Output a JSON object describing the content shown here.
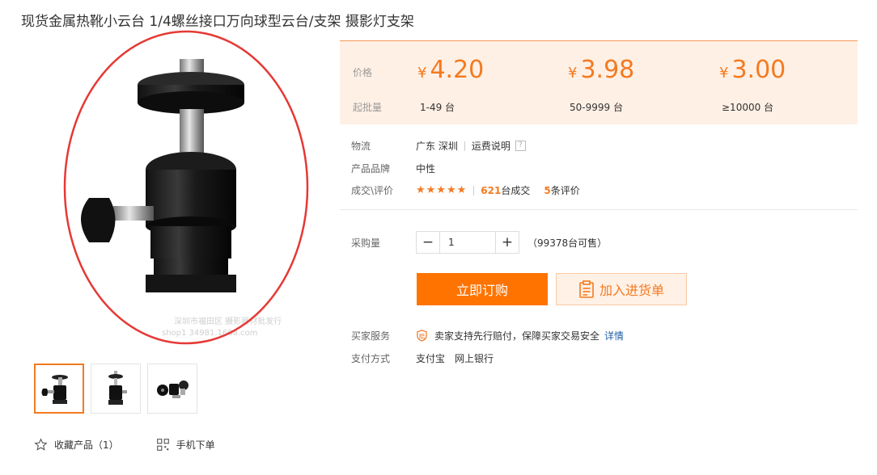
{
  "product": {
    "title": "现货金属热靴小云台 1/4螺丝接口万向球型云台/支架 摄影灯支架"
  },
  "main_image": {
    "watermark": "深圳市福田区**摄影器材批发行 shop1****34981.1688.com"
  },
  "gallery": {
    "selected_index": 0,
    "count": 3
  },
  "actions": {
    "favorite_label": "收藏产品（1）",
    "mobile_order_label": "手机下单"
  },
  "price_panel": {
    "price_label": "价格",
    "batch_label": "起批量",
    "currency_symbol": "¥",
    "tiers": [
      {
        "price": "4.20",
        "range": "1-49 台"
      },
      {
        "price": "3.98",
        "range": "50-9999 台"
      },
      {
        "price": "3.00",
        "range": "≥10000 台"
      }
    ]
  },
  "logistics": {
    "label": "物流",
    "location": "广东 深圳",
    "shipping_note": "运费说明",
    "help_glyph": "?"
  },
  "brand": {
    "label": "产品品牌",
    "value": "中性"
  },
  "transactions": {
    "label": "成交\\评价",
    "stars": "★★★★★",
    "rating": 5,
    "deals_count": "621",
    "deals_suffix": "台成交",
    "reviews_count": "5",
    "reviews_suffix": "条评价"
  },
  "purchase": {
    "label": "采购量",
    "minus": "−",
    "plus": "+",
    "quantity": "1",
    "available": "（99378台可售）"
  },
  "buttons": {
    "buy_now": "立即订购",
    "add_to_list": "加入进货单"
  },
  "buyer_service": {
    "label": "买家服务",
    "badge": "赔",
    "text": "卖家支持先行赔付，保障买家交易安全",
    "detail_link": "详情"
  },
  "payment": {
    "label": "支付方式",
    "methods": [
      "支付宝",
      "网上银行"
    ]
  },
  "colors": {
    "accent": "#f47a20",
    "buy_button": "#ff7300",
    "price_panel_bg": "#fff0e5",
    "highlight_circle": "#e53935"
  }
}
